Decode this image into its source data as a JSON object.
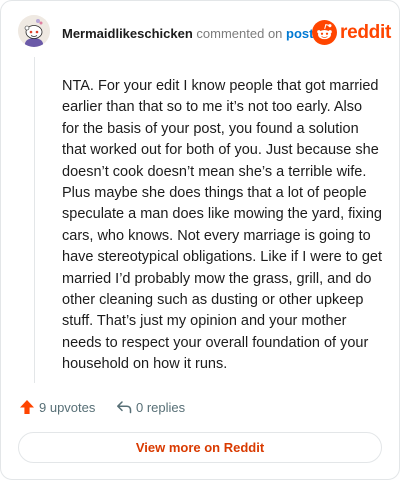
{
  "comment": {
    "username": "Mermaidlikeschicken",
    "action_text": "commented on",
    "target_link": "post",
    "body": "NTA. For your edit I know people that got married earlier than that so to me it’s not too early. Also for the basis of your post, you found a solution that worked out for both of you. Just because she doesn’t cook doesn’t mean she’s a terrible wife. Plus maybe she does things that a lot of people speculate a man does like mowing the yard, fixing cars, who knows. Not every marriage is going to have stereotypical obligations. Like if I were to get married I’d probably mow the grass, grill, and do other cleaning such as dusting or other upkeep stuff. That’s just my opinion and your mother needs to respect your overall foundation of your household on how it runs."
  },
  "brand": {
    "wordmark": "reddit",
    "logo_icon": "reddit-snoo-icon",
    "color": "#ff4500"
  },
  "footer": {
    "upvotes_label": "9 upvotes",
    "replies_label": "0 replies",
    "upvote_icon": "upvote-arrow-icon",
    "reply_icon": "reply-arrow-icon",
    "upvote_color": "#ff4500"
  },
  "cta": {
    "view_more_label": "View more on Reddit"
  },
  "colors": {
    "link": "#0079d3",
    "cta_text": "#d93a00",
    "muted": "#7c7c7c"
  }
}
